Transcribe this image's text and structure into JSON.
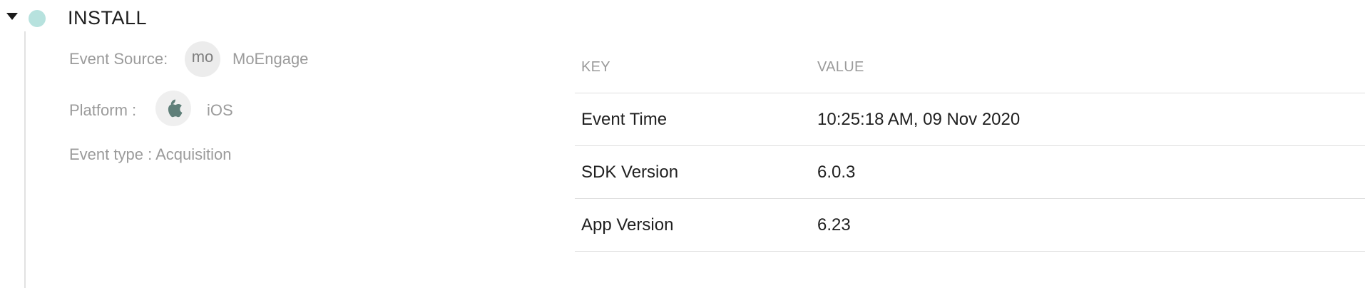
{
  "event": {
    "title": "INSTALL",
    "status_color": "#b7e2de"
  },
  "details": {
    "source_label": "Event Source:",
    "source_badge": "mo",
    "source_value": "MoEngage",
    "platform_label": "Platform :",
    "platform_icon": "apple-icon",
    "platform_value": "iOS",
    "type_text": "Event type : Acquisition"
  },
  "table": {
    "headers": {
      "key": "KEY",
      "value": "VALUE"
    },
    "rows": [
      {
        "key": "Event Time",
        "value": "10:25:18 AM, 09 Nov 2020"
      },
      {
        "key": "SDK Version",
        "value": "6.0.3"
      },
      {
        "key": "App Version",
        "value": "6.23"
      }
    ]
  }
}
